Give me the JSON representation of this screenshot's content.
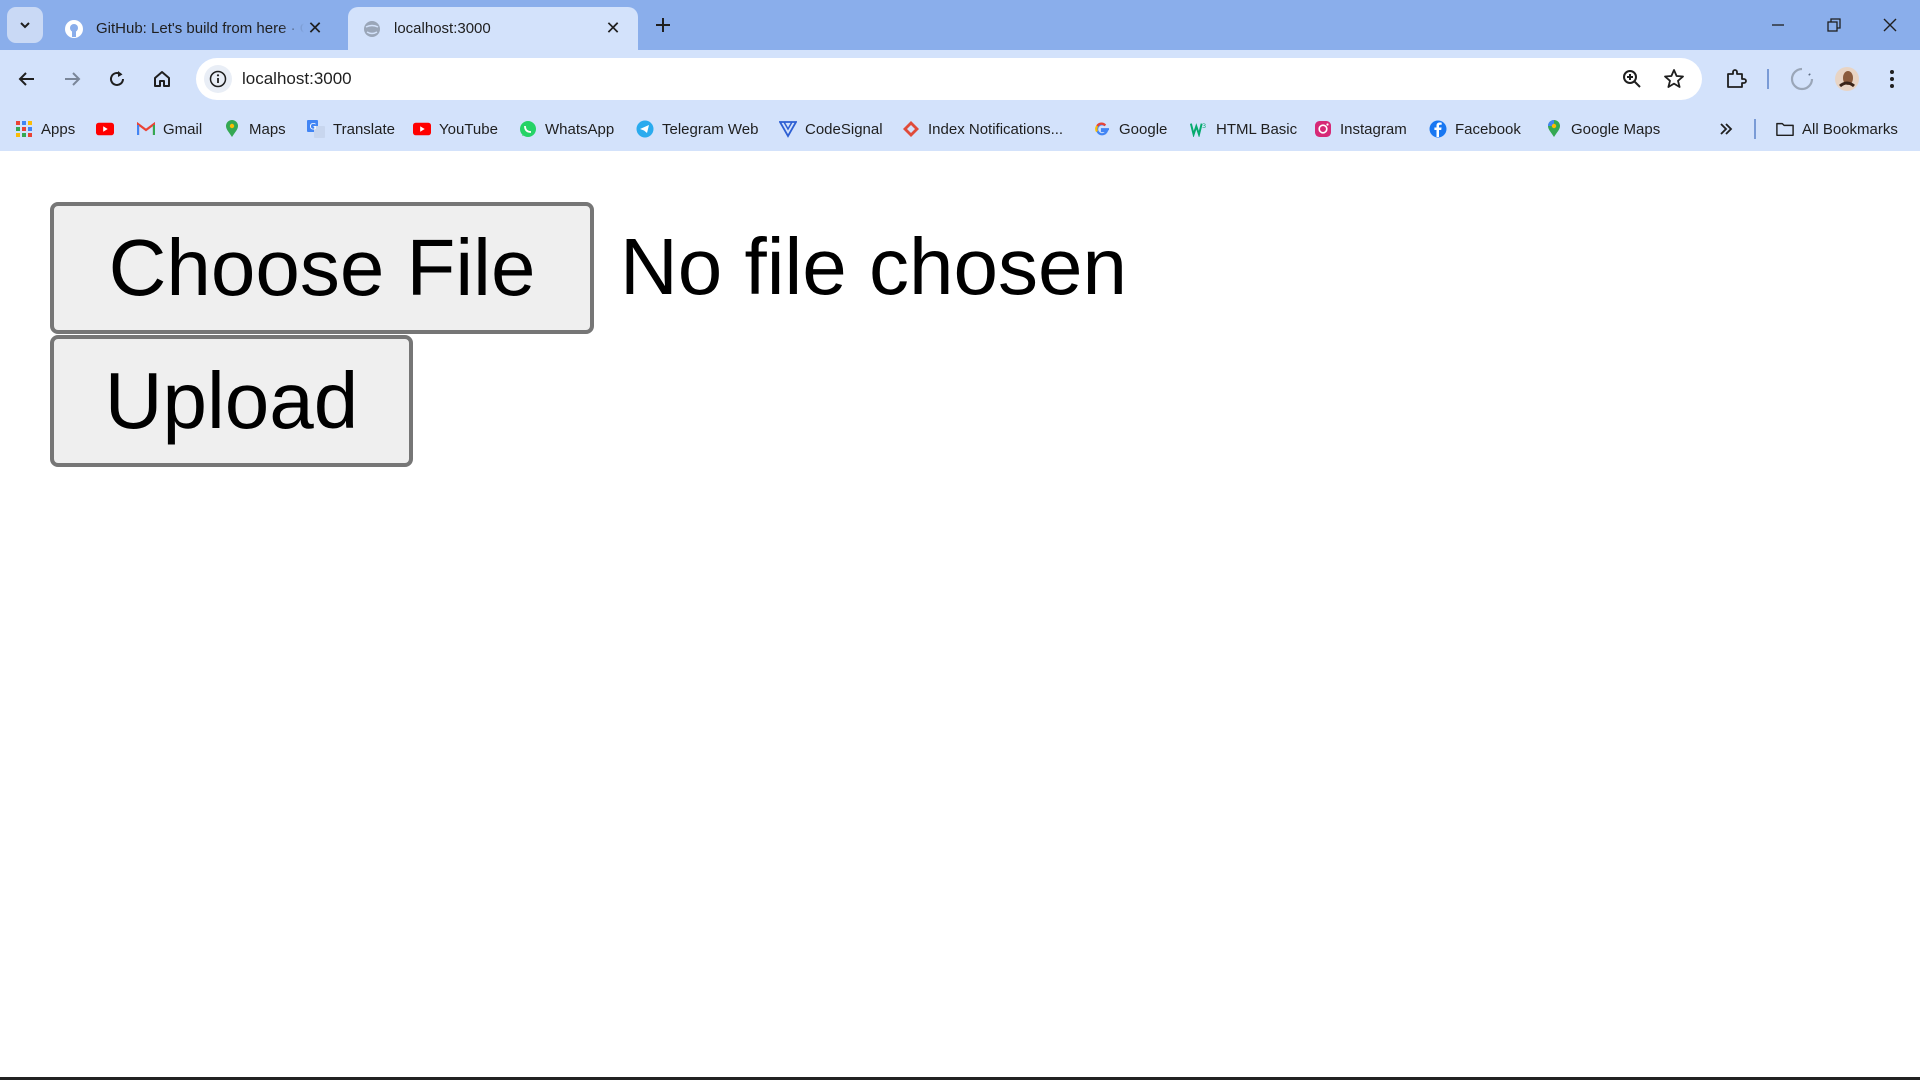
{
  "browser": {
    "tabs": [
      {
        "title": "GitHub: Let's build from here · GitHub",
        "active": false,
        "favicon": "github-icon"
      },
      {
        "title": "localhost:3000",
        "active": true,
        "favicon": "globe-icon"
      }
    ],
    "address": {
      "url": "localhost:3000"
    },
    "bookmarks": [
      {
        "label": "Apps",
        "icon": "apps-grid-icon"
      },
      {
        "label": "",
        "icon": "youtube-icon"
      },
      {
        "label": "Gmail",
        "icon": "gmail-icon"
      },
      {
        "label": "Maps",
        "icon": "maps-pin-icon"
      },
      {
        "label": "Translate",
        "icon": "translate-icon"
      },
      {
        "label": "YouTube",
        "icon": "youtube-icon"
      },
      {
        "label": "WhatsApp",
        "icon": "whatsapp-icon"
      },
      {
        "label": "Telegram Web",
        "icon": "telegram-icon"
      },
      {
        "label": "CodeSignal",
        "icon": "codesignal-icon"
      },
      {
        "label": "Index Notifications...",
        "icon": "index-icon"
      },
      {
        "label": "Google",
        "icon": "google-icon"
      },
      {
        "label": "HTML Basic",
        "icon": "w3schools-icon"
      },
      {
        "label": "Instagram",
        "icon": "instagram-icon"
      },
      {
        "label": "Facebook",
        "icon": "facebook-icon"
      },
      {
        "label": "Google Maps",
        "icon": "maps-pin-icon"
      }
    ],
    "all_bookmarks_label": "All Bookmarks"
  },
  "page": {
    "choose_file_label": "Choose File",
    "file_status": "No file chosen",
    "upload_label": "Upload"
  },
  "colors": {
    "frame": "#8aaeeb",
    "toolbar": "#d3e2fb",
    "button_bg": "#efefef",
    "button_border": "#767676"
  }
}
